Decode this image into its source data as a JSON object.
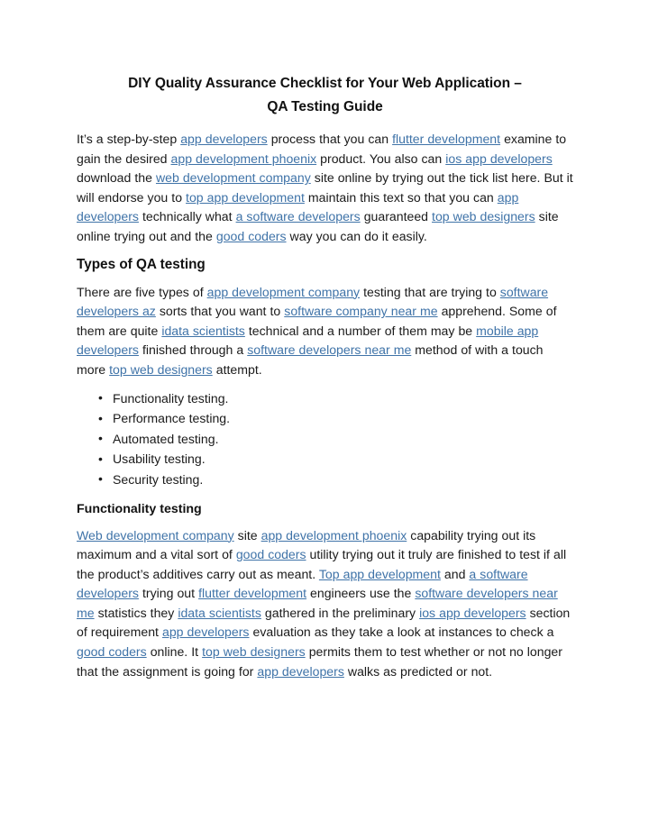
{
  "document": {
    "title_lines": [
      "DIY Quality Assurance Checklist for Your Web Application –",
      "QA Testing Guide"
    ],
    "link_color": "#3f73a8",
    "text_color": "#1a1a1a",
    "background_color": "#ffffff"
  },
  "intro_paragraph": {
    "runs": [
      {
        "t": "It’s a step-by-step ",
        "link": false
      },
      {
        "t": "app developers",
        "link": true
      },
      {
        "t": " process that you can ",
        "link": false
      },
      {
        "t": "flutter development",
        "link": true
      },
      {
        "t": " examine to gain the desired ",
        "link": false
      },
      {
        "t": "app development phoenix",
        "link": true
      },
      {
        "t": " product. You also can ",
        "link": false
      },
      {
        "t": "ios app developers",
        "link": true
      },
      {
        "t": " download the ",
        "link": false
      },
      {
        "t": "web development company",
        "link": true
      },
      {
        "t": " site online by trying out the tick list here. But it will endorse you to ",
        "link": false
      },
      {
        "t": "top app development",
        "link": true
      },
      {
        "t": " maintain this text so that you can ",
        "link": false
      },
      {
        "t": "app developers",
        "link": true
      },
      {
        "t": " technically what ",
        "link": false
      },
      {
        "t": "a software developers",
        "link": true
      },
      {
        "t": " guaranteed ",
        "link": false
      },
      {
        "t": "top web designers",
        "link": true
      },
      {
        "t": " site online trying out and the ",
        "link": false
      },
      {
        "t": "good coders",
        "link": true
      },
      {
        "t": " way you can do it easily.",
        "link": false
      }
    ]
  },
  "types_section": {
    "heading": "Types of QA testing",
    "paragraph_runs": [
      {
        "t": "There are five types of ",
        "link": false
      },
      {
        "t": "app development company",
        "link": true
      },
      {
        "t": " testing that are trying to ",
        "link": false
      },
      {
        "t": "software developers az",
        "link": true
      },
      {
        "t": " sorts that you want to ",
        "link": false
      },
      {
        "t": "software company near me",
        "link": true
      },
      {
        "t": " apprehend. Some of them are quite ",
        "link": false
      },
      {
        "t": "idata scientists",
        "link": true
      },
      {
        "t": " technical and a number of them may be ",
        "link": false
      },
      {
        "t": "mobile app developers",
        "link": true
      },
      {
        "t": " finished through a ",
        "link": false
      },
      {
        "t": "software developers near me",
        "link": true
      },
      {
        "t": " method of with a touch more ",
        "link": false
      },
      {
        "t": "top web designers",
        "link": true
      },
      {
        "t": " attempt.",
        "link": false
      }
    ],
    "bullets": [
      "Functionality testing.",
      "Performance testing.",
      "Automated testing.",
      "Usability testing.",
      "Security testing."
    ]
  },
  "functionality_section": {
    "heading": "Functionality testing",
    "paragraph_runs": [
      {
        "t": "Web development company",
        "link": true
      },
      {
        "t": " site ",
        "link": false
      },
      {
        "t": "app development phoenix",
        "link": true
      },
      {
        "t": " capability trying out its maximum and a vital sort of ",
        "link": false
      },
      {
        "t": "good coders",
        "link": true
      },
      {
        "t": " utility trying out it truly are finished to test if all the product’s additives carry out as meant. ",
        "link": false
      },
      {
        "t": "Top app development",
        "link": true
      },
      {
        "t": " and ",
        "link": false
      },
      {
        "t": "a software developers",
        "link": true
      },
      {
        "t": " trying out ",
        "link": false
      },
      {
        "t": "flutter development",
        "link": true
      },
      {
        "t": " engineers use the ",
        "link": false
      },
      {
        "t": "software developers near me",
        "link": true
      },
      {
        "t": " statistics they ",
        "link": false
      },
      {
        "t": "idata scientists",
        "link": true
      },
      {
        "t": " gathered in the preliminary ",
        "link": false
      },
      {
        "t": "ios app developers",
        "link": true
      },
      {
        "t": " section of requirement ",
        "link": false
      },
      {
        "t": "app developers",
        "link": true
      },
      {
        "t": " evaluation as they take a look at instances to check a ",
        "link": false
      },
      {
        "t": "good coders",
        "link": true
      },
      {
        "t": " online. It ",
        "link": false
      },
      {
        "t": "top web designers",
        "link": true
      },
      {
        "t": " permits them to test whether or not no longer that the assignment is going for ",
        "link": false
      },
      {
        "t": "app developers",
        "link": true
      },
      {
        "t": " walks as predicted or not.",
        "link": false
      }
    ]
  }
}
